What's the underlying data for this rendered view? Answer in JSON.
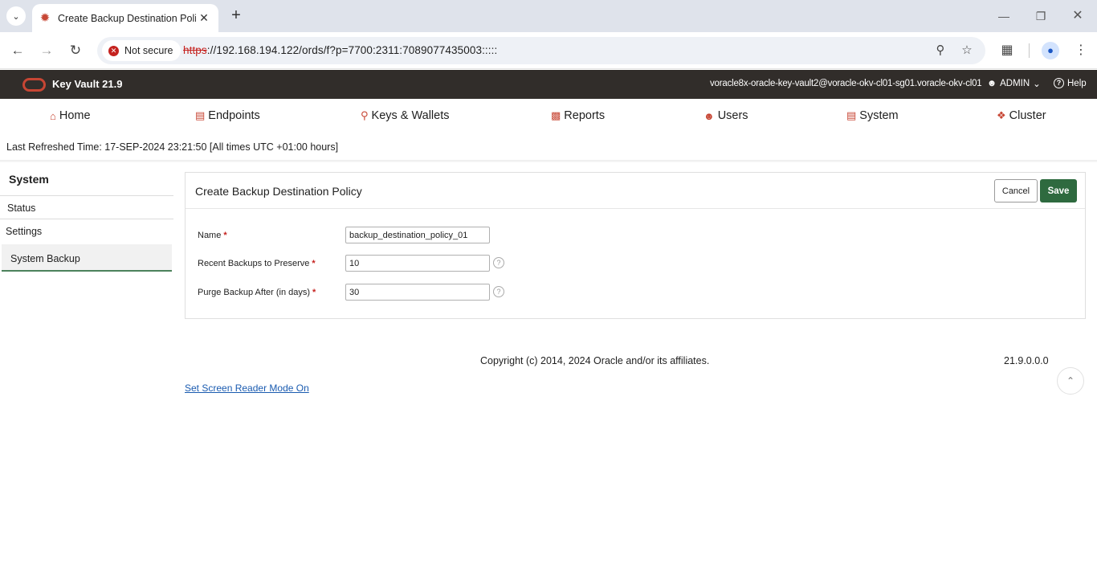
{
  "browser": {
    "tab_title": "Create Backup Destination Policy",
    "not_secure_label": "Not secure",
    "url_scheme": "https",
    "url_rest": "://192.168.194.122/ords/f?p=7700:2311:7089077435003:::::"
  },
  "header": {
    "app_title": "Key Vault 21.9",
    "hostname": "voracle8x-oracle-key-vault2@voracle-okv-cl01-sg01.voracle-okv-cl01",
    "user_label": "ADMIN",
    "help_label": "Help"
  },
  "nav": {
    "items": [
      {
        "label": "Home",
        "icon": "home-icon"
      },
      {
        "label": "Endpoints",
        "icon": "monitor-icon"
      },
      {
        "label": "Keys & Wallets",
        "icon": "key-icon"
      },
      {
        "label": "Reports",
        "icon": "bar-chart-icon"
      },
      {
        "label": "Users",
        "icon": "users-icon"
      },
      {
        "label": "System",
        "icon": "system-icon"
      },
      {
        "label": "Cluster",
        "icon": "cluster-icon"
      }
    ]
  },
  "refreshed_text": "Last Refreshed Time: 17-SEP-2024 23:21:50 [All times UTC +01:00 hours]",
  "sidebar": {
    "title": "System",
    "items": [
      "Status",
      "Settings",
      "System Backup"
    ]
  },
  "region": {
    "title": "Create Backup Destination Policy",
    "cancel_label": "Cancel",
    "save_label": "Save",
    "fields": {
      "name_label": "Name",
      "name_value": "backup_destination_policy_01",
      "preserve_label": "Recent Backups to Preserve",
      "preserve_value": "10",
      "purge_label": "Purge Backup After (in days)",
      "purge_value": "30"
    }
  },
  "footer": {
    "copyright": "Copyright (c) 2014, 2024 Oracle and/or its affiliates.",
    "version": "21.9.0.0.0",
    "screen_reader_link": "Set Screen Reader Mode On"
  },
  "colors": {
    "accent": "#c74634",
    "header_bg": "#312d2a",
    "save_button": "#2e6a3f"
  }
}
